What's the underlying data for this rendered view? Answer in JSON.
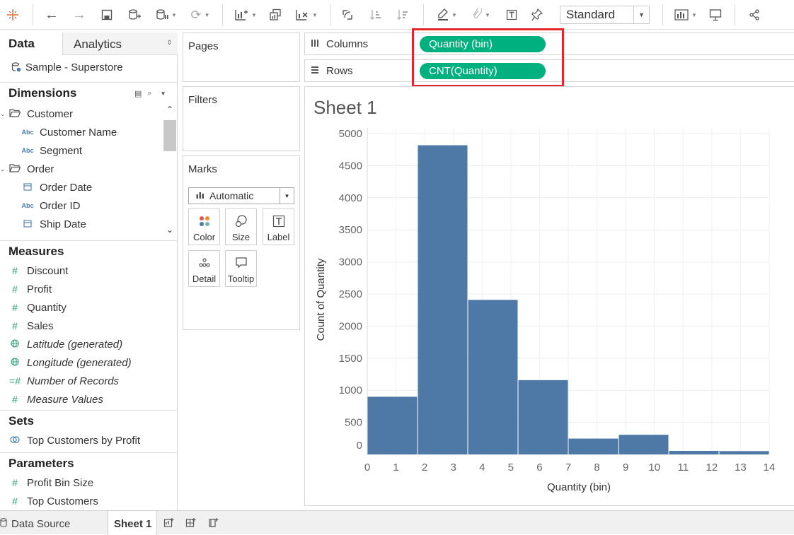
{
  "toolbar": {
    "view_mode": "Standard"
  },
  "data_pane": {
    "tabs": {
      "data": "Data",
      "analytics": "Analytics"
    },
    "datasource": "Sample - Superstore",
    "dimensions": {
      "title": "Dimensions",
      "items": [
        {
          "label": "Customer",
          "type": "folder"
        },
        {
          "label": "Customer Name",
          "type": "abc"
        },
        {
          "label": "Segment",
          "type": "abc"
        },
        {
          "label": "Order",
          "type": "folder"
        },
        {
          "label": "Order Date",
          "type": "date"
        },
        {
          "label": "Order ID",
          "type": "abc"
        },
        {
          "label": "Ship Date",
          "type": "date"
        }
      ]
    },
    "measures": {
      "title": "Measures",
      "items": [
        {
          "label": "Discount",
          "type": "number"
        },
        {
          "label": "Profit",
          "type": "number"
        },
        {
          "label": "Quantity",
          "type": "number"
        },
        {
          "label": "Sales",
          "type": "number"
        },
        {
          "label": "Latitude (generated)",
          "type": "geo"
        },
        {
          "label": "Longitude (generated)",
          "type": "geo"
        },
        {
          "label": "Number of Records",
          "type": "number"
        },
        {
          "label": "Measure Values",
          "type": "number"
        }
      ]
    },
    "sets": {
      "title": "Sets",
      "items": [
        {
          "label": "Top Customers by Profit"
        }
      ]
    },
    "parameters": {
      "title": "Parameters",
      "items": [
        {
          "label": "Profit Bin Size"
        },
        {
          "label": "Top Customers"
        }
      ]
    }
  },
  "cards": {
    "pages": "Pages",
    "filters": "Filters",
    "marks": {
      "title": "Marks",
      "type": "Automatic",
      "buttons": [
        "Color",
        "Size",
        "Label",
        "Detail",
        "Tooltip"
      ]
    }
  },
  "shelves": {
    "columns": {
      "label": "Columns",
      "pill": "Quantity (bin)"
    },
    "rows": {
      "label": "Rows",
      "pill": "CNT(Quantity)"
    }
  },
  "sheet": {
    "title": "Sheet 1"
  },
  "bottom_tabs": {
    "datasource": "Data Source",
    "sheet": "Sheet 1"
  },
  "colors": {
    "bar": "#4e79a7",
    "pill": "#00b180",
    "highlight": "#e3262b"
  },
  "chart_data": {
    "type": "bar",
    "xlabel": "Quantity (bin)",
    "ylabel": "Count of Quantity",
    "x_ticks": [
      0,
      1,
      2,
      3,
      4,
      5,
      6,
      7,
      8,
      9,
      10,
      11,
      12,
      13,
      14
    ],
    "y_ticks": [
      0,
      500,
      1000,
      1500,
      2000,
      2500,
      3000,
      3500,
      4000,
      4500,
      5000
    ],
    "ylim": [
      0,
      5000
    ],
    "xlim": [
      0,
      14
    ],
    "bins": [
      {
        "start": 0,
        "end": 1.75,
        "value": 899
      },
      {
        "start": 1.75,
        "end": 3.5,
        "value": 4818
      },
      {
        "start": 3.5,
        "end": 5.25,
        "value": 2409
      },
      {
        "start": 5.25,
        "end": 7.0,
        "value": 1158
      },
      {
        "start": 7.0,
        "end": 8.75,
        "value": 247
      },
      {
        "start": 8.75,
        "end": 10.5,
        "value": 306
      },
      {
        "start": 10.5,
        "end": 12.25,
        "value": 55
      },
      {
        "start": 12.25,
        "end": 14.0,
        "value": 52
      }
    ]
  }
}
